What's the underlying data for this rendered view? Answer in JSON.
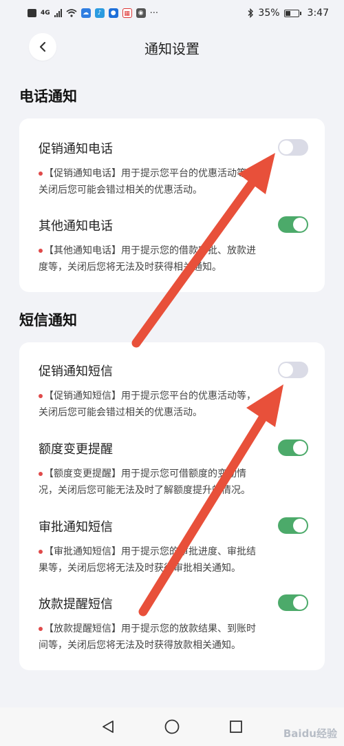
{
  "status_bar": {
    "left_icons": [
      "sim-icon",
      "signal-icon",
      "wifi-icon",
      "cloud-app-icon",
      "music-app-icon",
      "app-icon",
      "calendar-app-icon",
      "gallery-app-icon"
    ],
    "more": "···",
    "network": "4G",
    "bluetooth_icon": "bluetooth-icon",
    "battery": "35%",
    "battery_level": 0.35,
    "time": "3:47"
  },
  "header": {
    "back_icon": "chevron-left-icon",
    "title": "通知设置"
  },
  "sections": [
    {
      "title": "电话通知",
      "items": [
        {
          "label": "促销通知电话",
          "enabled": false,
          "desc_lines": [
            "【促销通知电话】用于提示您平台的优惠活动等，",
            "关闭后您可能会错过相关的优惠活动。"
          ]
        },
        {
          "label": "其他通知电话",
          "enabled": true,
          "desc_lines": [
            "【其他通知电话】用于提示您的借款审批、放款进",
            "度等，关闭后您将无法及时获得相关通知。"
          ]
        }
      ]
    },
    {
      "title": "短信通知",
      "items": [
        {
          "label": "促销通知短信",
          "enabled": false,
          "desc_lines": [
            "【促销通知短信】用于提示您平台的优惠活动等，",
            "关闭后您可能会错过相关的优惠活动。"
          ]
        },
        {
          "label": "额度变更提醒",
          "enabled": true,
          "desc_lines": [
            "【额度变更提醒】用于提示您可借额度的变动情",
            "况，关闭后您可能无法及时了解额度提升的情况。"
          ]
        },
        {
          "label": "审批通知短信",
          "enabled": true,
          "desc_lines": [
            "【审批通知短信】用于提示您的审批进度、审批结",
            "果等，关闭后您将无法及时获得审批相关通知。"
          ]
        },
        {
          "label": "放款提醒短信",
          "enabled": true,
          "desc_lines": [
            "【放款提醒短信】用于提示您的放款结果、到账时",
            "间等，关闭后您将无法及时获得放款相关通知。"
          ]
        }
      ]
    }
  ],
  "nav_bar": {
    "back_icon": "triangle-back-icon",
    "home_icon": "circle-home-icon",
    "recents_icon": "square-recents-icon"
  },
  "watermark": "Baidu经验",
  "colors": {
    "toggle_on": "#4caa6a",
    "toggle_off": "#dadbe6",
    "bullet": "#e04a4a",
    "arrow": "#e8503a",
    "background": "#f2f3f7"
  }
}
